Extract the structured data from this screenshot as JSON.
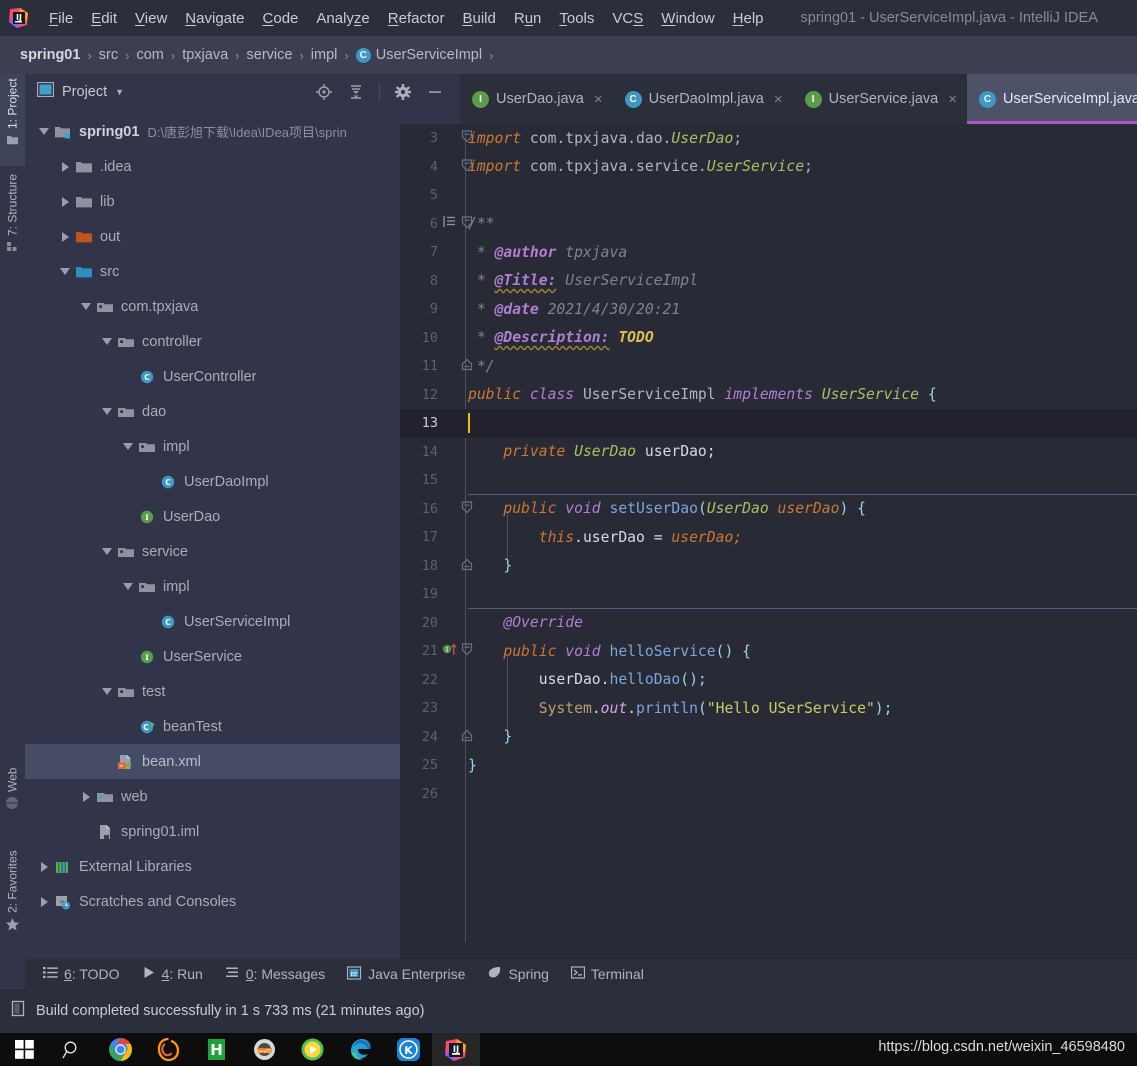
{
  "window": {
    "title": "spring01 - UserServiceImpl.java - IntelliJ IDEA",
    "logo_name": "intellij-idea-logo"
  },
  "menubar": {
    "items": [
      {
        "label": "File",
        "mnemonic": "F"
      },
      {
        "label": "Edit",
        "mnemonic": "E"
      },
      {
        "label": "View",
        "mnemonic": "V"
      },
      {
        "label": "Navigate",
        "mnemonic": "N"
      },
      {
        "label": "Code",
        "mnemonic": "C"
      },
      {
        "label": "Analyze",
        "mnemonic": "z"
      },
      {
        "label": "Refactor",
        "mnemonic": "R"
      },
      {
        "label": "Build",
        "mnemonic": "B"
      },
      {
        "label": "Run",
        "mnemonic": "u"
      },
      {
        "label": "Tools",
        "mnemonic": "T"
      },
      {
        "label": "VCS",
        "mnemonic": "S"
      },
      {
        "label": "Window",
        "mnemonic": "W"
      },
      {
        "label": "Help",
        "mnemonic": "H"
      }
    ]
  },
  "breadcrumb": {
    "items": [
      {
        "label": "spring01",
        "bold": true,
        "icon": null
      },
      {
        "label": "src",
        "bold": false,
        "icon": null
      },
      {
        "label": "com",
        "bold": false,
        "icon": null
      },
      {
        "label": "tpxjava",
        "bold": false,
        "icon": null
      },
      {
        "label": "service",
        "bold": false,
        "icon": null
      },
      {
        "label": "impl",
        "bold": false,
        "icon": null
      },
      {
        "label": "UserServiceImpl",
        "bold": false,
        "icon": "class-icon"
      }
    ],
    "separator": "›"
  },
  "left_stripe": {
    "tabs": [
      {
        "label": "1: Project",
        "mnemonic": "1",
        "icon": "folder-icon",
        "active": true
      },
      {
        "label": "7: Structure",
        "mnemonic": "7",
        "icon": "structure-icon",
        "active": false
      },
      {
        "label": "Web",
        "mnemonic": "",
        "icon": "globe-icon",
        "active": false
      },
      {
        "label": "2: Favorites",
        "mnemonic": "2",
        "icon": "star-icon",
        "active": false
      }
    ]
  },
  "project_panel": {
    "title": "Project",
    "title_icon": "project-view-icon",
    "dropdown_icon": "chevron-down-icon",
    "tools": [
      {
        "name": "locate-icon",
        "glyph": "target"
      },
      {
        "name": "collapse-all-icon",
        "glyph": "collapse"
      },
      {
        "name": "gear-icon",
        "glyph": "gear"
      },
      {
        "name": "hide-icon",
        "glyph": "minus"
      }
    ],
    "tree": [
      {
        "label": "spring01",
        "path": "D:\\唐彭旭下载\\Idea\\IDea项目\\sprin",
        "depth": 0,
        "state": "expanded",
        "icon": "module-folder-icon",
        "bold": true,
        "selected": false
      },
      {
        "label": ".idea",
        "path": "",
        "depth": 1,
        "state": "collapsed",
        "icon": "folder-gray-icon",
        "bold": false,
        "selected": false
      },
      {
        "label": "lib",
        "path": "",
        "depth": 1,
        "state": "collapsed",
        "icon": "folder-gray-icon",
        "bold": false,
        "selected": false
      },
      {
        "label": "out",
        "path": "",
        "depth": 1,
        "state": "collapsed",
        "icon": "folder-orange-icon",
        "bold": false,
        "selected": false
      },
      {
        "label": "src",
        "path": "",
        "depth": 1,
        "state": "expanded",
        "icon": "folder-blue-icon",
        "bold": false,
        "selected": false
      },
      {
        "label": "com.tpxjava",
        "path": "",
        "depth": 2,
        "state": "expanded",
        "icon": "package-icon",
        "bold": false,
        "selected": false
      },
      {
        "label": "controller",
        "path": "",
        "depth": 3,
        "state": "expanded",
        "icon": "package-icon",
        "bold": false,
        "selected": false
      },
      {
        "label": "UserController",
        "path": "",
        "depth": 4,
        "state": "leaf",
        "icon": "class-icon",
        "bold": false,
        "selected": false
      },
      {
        "label": "dao",
        "path": "",
        "depth": 3,
        "state": "expanded",
        "icon": "package-icon",
        "bold": false,
        "selected": false
      },
      {
        "label": "impl",
        "path": "",
        "depth": 4,
        "state": "expanded",
        "icon": "package-icon",
        "bold": false,
        "selected": false
      },
      {
        "label": "UserDaoImpl",
        "path": "",
        "depth": 5,
        "state": "leaf",
        "icon": "class-icon",
        "bold": false,
        "selected": false
      },
      {
        "label": "UserDao",
        "path": "",
        "depth": 4,
        "state": "leaf",
        "icon": "interface-icon",
        "bold": false,
        "selected": false
      },
      {
        "label": "service",
        "path": "",
        "depth": 3,
        "state": "expanded",
        "icon": "package-icon",
        "bold": false,
        "selected": false
      },
      {
        "label": "impl",
        "path": "",
        "depth": 4,
        "state": "expanded",
        "icon": "package-icon",
        "bold": false,
        "selected": false
      },
      {
        "label": "UserServiceImpl",
        "path": "",
        "depth": 5,
        "state": "leaf",
        "icon": "class-icon",
        "bold": false,
        "selected": false
      },
      {
        "label": "UserService",
        "path": "",
        "depth": 4,
        "state": "leaf",
        "icon": "interface-icon",
        "bold": false,
        "selected": false
      },
      {
        "label": "test",
        "path": "",
        "depth": 3,
        "state": "expanded",
        "icon": "package-icon",
        "bold": false,
        "selected": false
      },
      {
        "label": "beanTest",
        "path": "",
        "depth": 4,
        "state": "leaf",
        "icon": "test-class-icon",
        "bold": false,
        "selected": false
      },
      {
        "label": "bean.xml",
        "path": "",
        "depth": 3,
        "state": "leaf",
        "icon": "spring-xml-icon",
        "bold": false,
        "selected": true
      },
      {
        "label": "web",
        "path": "",
        "depth": 2,
        "state": "collapsed",
        "icon": "web-folder-icon",
        "bold": false,
        "selected": false
      },
      {
        "label": "spring01.iml",
        "path": "",
        "depth": 2,
        "state": "leaf",
        "icon": "iml-file-icon",
        "bold": false,
        "selected": false
      },
      {
        "label": "External Libraries",
        "path": "",
        "depth": 0,
        "state": "collapsed",
        "icon": "libraries-icon",
        "bold": false,
        "selected": false
      },
      {
        "label": "Scratches and Consoles",
        "path": "",
        "depth": 0,
        "state": "collapsed",
        "icon": "scratches-icon",
        "bold": false,
        "selected": false
      }
    ]
  },
  "editor_tabs": [
    {
      "label": "UserDao.java",
      "icon": "interface-icon",
      "active": false,
      "close": "×"
    },
    {
      "label": "UserDaoImpl.java",
      "icon": "class-icon",
      "active": false,
      "close": "×"
    },
    {
      "label": "UserService.java",
      "icon": "interface-icon",
      "active": false,
      "close": "×"
    },
    {
      "label": "UserServiceImpl.java",
      "icon": "class-icon",
      "active": true,
      "close": "×"
    }
  ],
  "editor": {
    "active_line": 13,
    "caret_color": "#f2c200",
    "first_visible_line": 3,
    "lines": [
      {
        "n": 3,
        "fold": "⊖",
        "tokens": [
          {
            "t": "import ",
            "c": "kw"
          },
          {
            "t": "com.tpxjava.dao.",
            "c": "typ2"
          },
          {
            "t": "UserDao",
            "c": "typ"
          },
          {
            "t": ";",
            "c": "typ2"
          }
        ]
      },
      {
        "n": 4,
        "fold": "⊖",
        "tokens": [
          {
            "t": "import ",
            "c": "kw"
          },
          {
            "t": "com.tpxjava.service.",
            "c": "typ2"
          },
          {
            "t": "UserService",
            "c": "typ"
          },
          {
            "t": ";",
            "c": "typ2"
          }
        ]
      },
      {
        "n": 5,
        "fold": "",
        "tokens": []
      },
      {
        "n": 6,
        "fold": "⊖",
        "tokens": [
          {
            "t": "/**",
            "c": "cmt"
          }
        ]
      },
      {
        "n": 7,
        "fold": "",
        "tokens": [
          {
            "t": " * ",
            "c": "cmt"
          },
          {
            "t": "@author",
            "c": "jdoc-tag"
          },
          {
            "t": " tpxjava",
            "c": "cmt"
          }
        ]
      },
      {
        "n": 8,
        "fold": "",
        "tokens": [
          {
            "t": " * ",
            "c": "cmt"
          },
          {
            "t": "@Title:",
            "c": "jdoc-tag err-underline"
          },
          {
            "t": " UserServiceImpl",
            "c": "cmt"
          }
        ]
      },
      {
        "n": 9,
        "fold": "",
        "tokens": [
          {
            "t": " * ",
            "c": "cmt"
          },
          {
            "t": "@date",
            "c": "jdoc-tag"
          },
          {
            "t": " 2021/4/30/20:21",
            "c": "cmt"
          }
        ]
      },
      {
        "n": 10,
        "fold": "",
        "tokens": [
          {
            "t": " * ",
            "c": "cmt"
          },
          {
            "t": "@Description:",
            "c": "jdoc-tag err-underline"
          },
          {
            "t": " ",
            "c": "cmt"
          },
          {
            "t": "TODO",
            "c": "todo"
          }
        ]
      },
      {
        "n": 11,
        "fold": "⊝",
        "tokens": [
          {
            "t": " */",
            "c": "cmt"
          }
        ]
      },
      {
        "n": 12,
        "fold": "",
        "tokens": [
          {
            "t": "public ",
            "c": "kw"
          },
          {
            "t": "class ",
            "c": "kw2"
          },
          {
            "t": "UserServiceImpl ",
            "c": "typ2"
          },
          {
            "t": "implements ",
            "c": "kw2"
          },
          {
            "t": "UserService ",
            "c": "typ"
          },
          {
            "t": "{",
            "c": "punct"
          }
        ]
      },
      {
        "n": 13,
        "fold": "",
        "tokens": []
      },
      {
        "n": 14,
        "fold": "",
        "tokens": [
          {
            "t": "    ",
            "c": "id"
          },
          {
            "t": "private ",
            "c": "kw"
          },
          {
            "t": "UserDao ",
            "c": "typ"
          },
          {
            "t": "userDao;",
            "c": "id"
          }
        ]
      },
      {
        "n": 15,
        "fold": "",
        "tokens": []
      },
      {
        "n": 16,
        "fold": "⊖",
        "tokens": [
          {
            "t": "    ",
            "c": "id"
          },
          {
            "t": "public ",
            "c": "kw"
          },
          {
            "t": "void ",
            "c": "kw2"
          },
          {
            "t": "setUserDao",
            "c": "fn"
          },
          {
            "t": "(",
            "c": "punct"
          },
          {
            "t": "UserDao ",
            "c": "typ"
          },
          {
            "t": "userDao",
            "c": "kw"
          },
          {
            "t": ") ",
            "c": "punct"
          },
          {
            "t": "{",
            "c": "punct"
          }
        ]
      },
      {
        "n": 17,
        "fold": "",
        "tokens": [
          {
            "t": "        ",
            "c": "id"
          },
          {
            "t": "this",
            "c": "kw"
          },
          {
            "t": ".userDao ",
            "c": "id"
          },
          {
            "t": "= ",
            "c": "id"
          },
          {
            "t": "userDao;",
            "c": "kw"
          }
        ]
      },
      {
        "n": 18,
        "fold": "⊝",
        "tokens": [
          {
            "t": "    ",
            "c": "id"
          },
          {
            "t": "}",
            "c": "punct"
          }
        ]
      },
      {
        "n": 19,
        "fold": "",
        "tokens": []
      },
      {
        "n": 20,
        "fold": "",
        "tokens": [
          {
            "t": "    ",
            "c": "id"
          },
          {
            "t": "@Override",
            "c": "kw2"
          }
        ]
      },
      {
        "n": 21,
        "fold": "⊖",
        "gutter": "implements-method-icon",
        "tokens": [
          {
            "t": "    ",
            "c": "id"
          },
          {
            "t": "public ",
            "c": "kw"
          },
          {
            "t": "void ",
            "c": "kw2"
          },
          {
            "t": "helloService",
            "c": "fn"
          },
          {
            "t": "() ",
            "c": "punct"
          },
          {
            "t": "{",
            "c": "punct"
          }
        ]
      },
      {
        "n": 22,
        "fold": "",
        "tokens": [
          {
            "t": "        ",
            "c": "id"
          },
          {
            "t": "userDao",
            "c": "id"
          },
          {
            "t": ".",
            "c": "id"
          },
          {
            "t": "helloDao",
            "c": "fn"
          },
          {
            "t": "();",
            "c": "punct"
          }
        ]
      },
      {
        "n": 23,
        "fold": "",
        "tokens": [
          {
            "t": "        ",
            "c": "id"
          },
          {
            "t": "System",
            "c": "ann"
          },
          {
            "t": ".",
            "c": "id"
          },
          {
            "t": "out",
            "c": "static-f"
          },
          {
            "t": ".",
            "c": "id"
          },
          {
            "t": "println",
            "c": "fn"
          },
          {
            "t": "(",
            "c": "punct"
          },
          {
            "t": "\"Hello USerService\"",
            "c": "str"
          },
          {
            "t": ");",
            "c": "punct"
          }
        ]
      },
      {
        "n": 24,
        "fold": "⊝",
        "tokens": [
          {
            "t": "    ",
            "c": "id"
          },
          {
            "t": "}",
            "c": "punct"
          }
        ]
      },
      {
        "n": 25,
        "fold": "",
        "tokens": [
          {
            "t": "}",
            "c": "punct"
          }
        ]
      },
      {
        "n": 26,
        "fold": "",
        "tokens": []
      }
    ]
  },
  "tool_window_bar": [
    {
      "label": "6: TODO",
      "mnemonic": "6",
      "icon": "todo-list-icon"
    },
    {
      "label": "4: Run",
      "mnemonic": "4",
      "icon": "run-icon"
    },
    {
      "label": "0: Messages",
      "mnemonic": "0",
      "icon": "messages-icon"
    },
    {
      "label": "Java Enterprise",
      "mnemonic": "",
      "icon": "java-enterprise-icon"
    },
    {
      "label": "Spring",
      "mnemonic": "",
      "icon": "spring-leaf-icon"
    },
    {
      "label": "Terminal",
      "mnemonic": "",
      "icon": "terminal-icon"
    }
  ],
  "status_bar": {
    "icon": "build-icon",
    "message": "Build completed successfully in 1 s 733 ms (21 minutes ago)"
  },
  "taskbar": {
    "url_watermark": "https://blog.csdn.net/weixin_46598480",
    "items": [
      {
        "name": "windows-start-icon"
      },
      {
        "name": "search-icon"
      },
      {
        "name": "chrome-icon"
      },
      {
        "name": "firefox-dev-icon"
      },
      {
        "name": "hbuilder-icon"
      },
      {
        "name": "javaee-icon"
      },
      {
        "name": "media-player-icon"
      },
      {
        "name": "edge-icon"
      },
      {
        "name": "kugou-icon"
      },
      {
        "name": "intellij-idea-taskbar-icon"
      }
    ]
  },
  "colors": {
    "accent_tab_underline": "#b452c9",
    "editor_bg": "#282a36",
    "panel_bg": "#32354a",
    "chrome_bg": "#2b2e3b",
    "selection_bg": "#474c66"
  }
}
